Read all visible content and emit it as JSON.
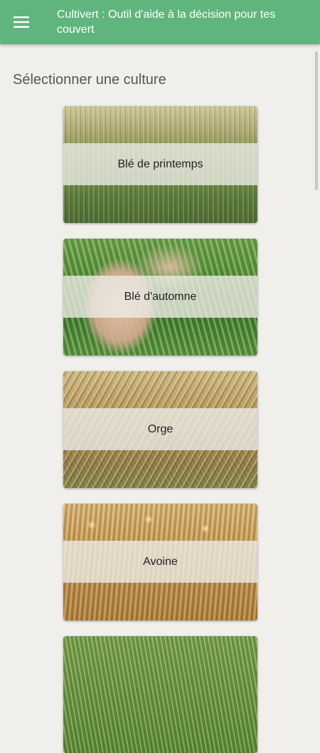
{
  "appbar": {
    "title": "Cultivert : Outil d'aide à la décision pour tes couvert",
    "menu_icon": "hamburger-menu-icon",
    "color": "#5fb57d"
  },
  "main": {
    "heading": "Sélectionner une culture",
    "crops": [
      {
        "label": "Blé de printemps",
        "image": "wheat-field-photo"
      },
      {
        "label": "Blé d'automne",
        "image": "hand-holding-wheat-photo"
      },
      {
        "label": "Orge",
        "image": "barley-field-photo"
      },
      {
        "label": "Avoine",
        "image": "oat-field-photo"
      }
    ]
  }
}
